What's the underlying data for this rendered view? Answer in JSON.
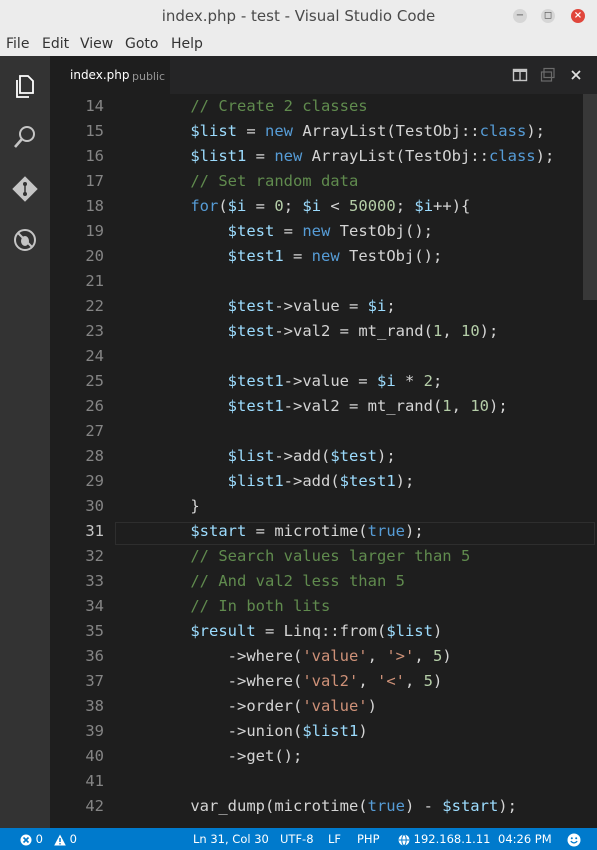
{
  "window": {
    "title": "index.php - test - Visual Studio Code",
    "minimize": "−",
    "maximize": "◻",
    "close": "×"
  },
  "menu": [
    "File",
    "Edit",
    "View",
    "Goto",
    "Help"
  ],
  "activity_bar": [
    "explorer-icon",
    "search-icon",
    "git-icon",
    "debug-icon"
  ],
  "tab": {
    "filename": "index.php",
    "folder": "public"
  },
  "tab_actions": [
    "split-editor-icon",
    "open-changes-icon",
    "close-icon"
  ],
  "colors": {
    "keyword": "#569cd6",
    "variable": "#9cdcfe",
    "comment": "#608b4e",
    "string": "#ce9178",
    "number": "#b5cea8",
    "text": "#d4d4d4",
    "statusbar": "#007acc"
  },
  "editor": {
    "active_line": 31,
    "lines": [
      {
        "n": "14",
        "tokens": [
          [
            "    ",
            "t"
          ],
          [
            "// Create 2 classes",
            "c"
          ]
        ]
      },
      {
        "n": "15",
        "tokens": [
          [
            "    ",
            "t"
          ],
          [
            "$list",
            "v"
          ],
          [
            " = ",
            "t"
          ],
          [
            "new",
            "k"
          ],
          [
            " ArrayList(TestObj::",
            "t"
          ],
          [
            "class",
            "k"
          ],
          [
            ");",
            "t"
          ]
        ]
      },
      {
        "n": "16",
        "tokens": [
          [
            "    ",
            "t"
          ],
          [
            "$list1",
            "v"
          ],
          [
            " = ",
            "t"
          ],
          [
            "new",
            "k"
          ],
          [
            " ArrayList(TestObj::",
            "t"
          ],
          [
            "class",
            "k"
          ],
          [
            ");",
            "t"
          ]
        ]
      },
      {
        "n": "17",
        "tokens": [
          [
            "    ",
            "t"
          ],
          [
            "// Set random data",
            "c"
          ]
        ]
      },
      {
        "n": "18",
        "tokens": [
          [
            "    ",
            "t"
          ],
          [
            "for",
            "k"
          ],
          [
            "(",
            "t"
          ],
          [
            "$i",
            "v"
          ],
          [
            " = ",
            "t"
          ],
          [
            "0",
            "n"
          ],
          [
            "; ",
            "t"
          ],
          [
            "$i",
            "v"
          ],
          [
            " < ",
            "t"
          ],
          [
            "50000",
            "n"
          ],
          [
            "; ",
            "t"
          ],
          [
            "$i",
            "v"
          ],
          [
            "++){",
            "t"
          ]
        ]
      },
      {
        "n": "19",
        "tokens": [
          [
            "        ",
            "t"
          ],
          [
            "$test",
            "v"
          ],
          [
            " = ",
            "t"
          ],
          [
            "new",
            "k"
          ],
          [
            " TestObj();",
            "t"
          ]
        ]
      },
      {
        "n": "20",
        "tokens": [
          [
            "        ",
            "t"
          ],
          [
            "$test1",
            "v"
          ],
          [
            " = ",
            "t"
          ],
          [
            "new",
            "k"
          ],
          [
            " TestObj();",
            "t"
          ]
        ]
      },
      {
        "n": "21",
        "tokens": []
      },
      {
        "n": "22",
        "tokens": [
          [
            "        ",
            "t"
          ],
          [
            "$test",
            "v"
          ],
          [
            "->value = ",
            "t"
          ],
          [
            "$i",
            "v"
          ],
          [
            ";",
            "t"
          ]
        ]
      },
      {
        "n": "23",
        "tokens": [
          [
            "        ",
            "t"
          ],
          [
            "$test",
            "v"
          ],
          [
            "->val2 = mt_rand(",
            "t"
          ],
          [
            "1",
            "n"
          ],
          [
            ", ",
            "t"
          ],
          [
            "10",
            "n"
          ],
          [
            ");",
            "t"
          ]
        ]
      },
      {
        "n": "24",
        "tokens": []
      },
      {
        "n": "25",
        "tokens": [
          [
            "        ",
            "t"
          ],
          [
            "$test1",
            "v"
          ],
          [
            "->value = ",
            "t"
          ],
          [
            "$i",
            "v"
          ],
          [
            " * ",
            "t"
          ],
          [
            "2",
            "n"
          ],
          [
            ";",
            "t"
          ]
        ]
      },
      {
        "n": "26",
        "tokens": [
          [
            "        ",
            "t"
          ],
          [
            "$test1",
            "v"
          ],
          [
            "->val2 = mt_rand(",
            "t"
          ],
          [
            "1",
            "n"
          ],
          [
            ", ",
            "t"
          ],
          [
            "10",
            "n"
          ],
          [
            ");",
            "t"
          ]
        ]
      },
      {
        "n": "27",
        "tokens": []
      },
      {
        "n": "28",
        "tokens": [
          [
            "        ",
            "t"
          ],
          [
            "$list",
            "v"
          ],
          [
            "->add(",
            "t"
          ],
          [
            "$test",
            "v"
          ],
          [
            ");",
            "t"
          ]
        ]
      },
      {
        "n": "29",
        "tokens": [
          [
            "        ",
            "t"
          ],
          [
            "$list1",
            "v"
          ],
          [
            "->add(",
            "t"
          ],
          [
            "$test1",
            "v"
          ],
          [
            ");",
            "t"
          ]
        ]
      },
      {
        "n": "30",
        "tokens": [
          [
            "    }",
            "t"
          ]
        ]
      },
      {
        "n": "31",
        "tokens": [
          [
            "    ",
            "t"
          ],
          [
            "$start",
            "v"
          ],
          [
            " = microtime(",
            "t"
          ],
          [
            "true",
            "k"
          ],
          [
            ");",
            "t"
          ]
        ]
      },
      {
        "n": "32",
        "tokens": [
          [
            "    ",
            "t"
          ],
          [
            "// Search values larger than 5",
            "c"
          ]
        ]
      },
      {
        "n": "33",
        "tokens": [
          [
            "    ",
            "t"
          ],
          [
            "// And val2 less than 5",
            "c"
          ]
        ]
      },
      {
        "n": "34",
        "tokens": [
          [
            "    ",
            "t"
          ],
          [
            "// In both lits",
            "c"
          ]
        ]
      },
      {
        "n": "35",
        "tokens": [
          [
            "    ",
            "t"
          ],
          [
            "$result",
            "v"
          ],
          [
            " = Linq::from(",
            "t"
          ],
          [
            "$list",
            "v"
          ],
          [
            ")",
            "t"
          ]
        ]
      },
      {
        "n": "36",
        "tokens": [
          [
            "        ->where(",
            "t"
          ],
          [
            "'value'",
            "s"
          ],
          [
            ", ",
            "t"
          ],
          [
            "'>'",
            "s"
          ],
          [
            ", ",
            "t"
          ],
          [
            "5",
            "n"
          ],
          [
            ")",
            "t"
          ]
        ]
      },
      {
        "n": "37",
        "tokens": [
          [
            "        ->where(",
            "t"
          ],
          [
            "'val2'",
            "s"
          ],
          [
            ", ",
            "t"
          ],
          [
            "'<'",
            "s"
          ],
          [
            ", ",
            "t"
          ],
          [
            "5",
            "n"
          ],
          [
            ")",
            "t"
          ]
        ]
      },
      {
        "n": "38",
        "tokens": [
          [
            "        ->order(",
            "t"
          ],
          [
            "'value'",
            "s"
          ],
          [
            ")",
            "t"
          ]
        ]
      },
      {
        "n": "39",
        "tokens": [
          [
            "        ->union(",
            "t"
          ],
          [
            "$list1",
            "v"
          ],
          [
            ")",
            "t"
          ]
        ]
      },
      {
        "n": "40",
        "tokens": [
          [
            "        ->get();",
            "t"
          ]
        ]
      },
      {
        "n": "41",
        "tokens": []
      },
      {
        "n": "42",
        "tokens": [
          [
            "    var_dump(microtime(",
            "t"
          ],
          [
            "true",
            "k"
          ],
          [
            ") - ",
            "t"
          ],
          [
            "$start",
            "v"
          ],
          [
            ");",
            "t"
          ]
        ]
      }
    ]
  },
  "status": {
    "errors": "0",
    "warnings": "0",
    "position": "Ln 31, Col 30",
    "encoding": "UTF-8",
    "eol": "LF",
    "language": "PHP",
    "host": "192.168.1.11",
    "time": "04:26 PM",
    "feedback_icon": "smiley-icon"
  }
}
